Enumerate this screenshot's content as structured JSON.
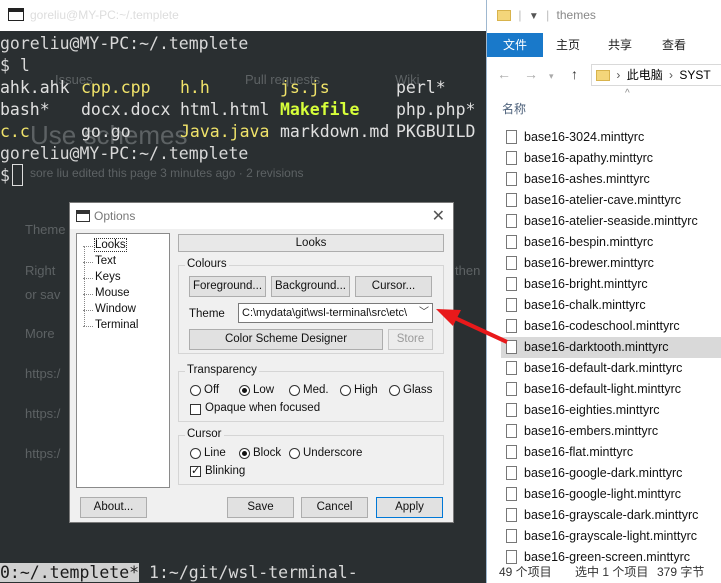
{
  "terminal": {
    "title": "goreliu@MY-PC:~/.templete",
    "prompt_host": "goreliu@MY-PC:~/.templete",
    "cmd_line": "$ l",
    "files_row1": [
      "ahk.ahk",
      "cpp.cpp",
      "h.h",
      "js.js",
      "perl*"
    ],
    "files_row2": [
      "bash*",
      "docx.docx",
      "html.html",
      "Makefile",
      "php.php*"
    ],
    "files_row3": [
      "c.c",
      "go.go",
      "Java.java",
      "markdown.md",
      "PKGBUILD"
    ],
    "prompt_host2": "goreliu@MY-PC:~/.templete",
    "prompt2": "$",
    "bg_ghost": {
      "heading": "Use schemes",
      "meta": "sore liu edited this page 3 minutes ago · 2 revisions",
      "theme": "Theme",
      "right": "Right",
      "orsav": "or sav",
      "more": "More",
      "https1": "https:/",
      "https2": "https:/",
      "https3": "https:/",
      "tab1": "Pull requests",
      "tab2": "Wiki",
      "tab3": "Issues",
      "then": "then"
    },
    "status_active": "0:~/.templete*",
    "status_rest": " 1:~/git/wsl-terminal-"
  },
  "options_dialog": {
    "title": "Options",
    "tree": [
      "Looks",
      "Text",
      "Keys",
      "Mouse",
      "Window",
      "Terminal"
    ],
    "looks_header": "Looks",
    "colours_label": "Colours",
    "foreground_btn": "Foreground...",
    "background_btn": "Background...",
    "cursor_btn": "Cursor...",
    "theme_label": "Theme",
    "theme_value": "C:\\mydata\\git\\wsl-terminal\\src\\etc\\",
    "scheme_designer_btn": "Color Scheme Designer",
    "store_btn": "Store",
    "transparency_label": "Transparency",
    "transparency_options": [
      "Off",
      "Low",
      "Med.",
      "High",
      "Glass"
    ],
    "transparency_selected": "Low",
    "opaque_label": "Opaque when focused",
    "cursor_label": "Cursor",
    "cursor_options": [
      "Line",
      "Block",
      "Underscore"
    ],
    "cursor_selected": "Block",
    "blinking_label": "Blinking",
    "about_btn": "About...",
    "save_btn": "Save",
    "cancel_btn": "Cancel",
    "apply_btn": "Apply"
  },
  "explorer": {
    "title": "themes",
    "ribbon_tabs": [
      "文件",
      "主页",
      "共享",
      "查看"
    ],
    "address_parts": [
      "此电脑",
      "SYST"
    ],
    "column_header": "名称",
    "files": [
      "base16-3024.minttyrc",
      "base16-apathy.minttyrc",
      "base16-ashes.minttyrc",
      "base16-atelier-cave.minttyrc",
      "base16-atelier-seaside.minttyrc",
      "base16-bespin.minttyrc",
      "base16-brewer.minttyrc",
      "base16-bright.minttyrc",
      "base16-chalk.minttyrc",
      "base16-codeschool.minttyrc",
      "base16-darktooth.minttyrc",
      "base16-default-dark.minttyrc",
      "base16-default-light.minttyrc",
      "base16-eighties.minttyrc",
      "base16-embers.minttyrc",
      "base16-flat.minttyrc",
      "base16-google-dark.minttyrc",
      "base16-google-light.minttyrc",
      "base16-grayscale-dark.minttyrc",
      "base16-grayscale-light.minttyrc",
      "base16-green-screen.minttyrc"
    ],
    "selected_file": "base16-darktooth.minttyrc",
    "status_count": "49 个项目",
    "status_selected": "选中 1 个项目",
    "status_size": "379 字节"
  },
  "colors": {
    "terminal_bg": "#2a2f31",
    "accent_blue": "#1979ca",
    "arrow_red": "#e8191b",
    "file_yellow": "#f0e36a",
    "makefile_green": "#d7ff3a"
  }
}
